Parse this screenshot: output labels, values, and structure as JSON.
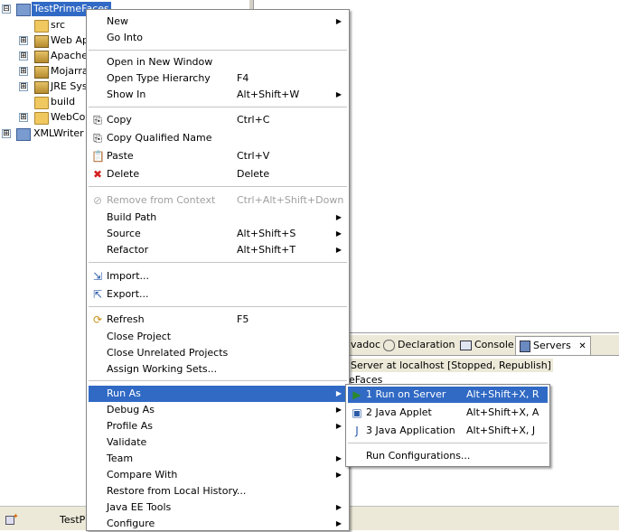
{
  "explorer": {
    "items": [
      {
        "label": "TestPrimeFaces",
        "expander": "⊟"
      },
      {
        "label": "src"
      },
      {
        "label": "Web Ap",
        "expander": "⊞"
      },
      {
        "label": "Apache",
        "expander": "⊞"
      },
      {
        "label": "Mojarra",
        "expander": "⊞"
      },
      {
        "label": "JRE Sys",
        "expander": "⊞"
      },
      {
        "label": "build"
      },
      {
        "label": "WebCor",
        "expander": "⊞"
      },
      {
        "label": "XMLWriter",
        "expander": "⊞"
      }
    ]
  },
  "bottom_tabs": {
    "javadoc": "vadoc",
    "declaration": "Declaration",
    "console": "Console",
    "servers": "Servers",
    "close": "✕"
  },
  "servers_view": {
    "server_line": "Server at localhost  [Stopped, Republish]",
    "child_line": "eFaces"
  },
  "statusbar": {
    "text": "TestPr"
  },
  "context_menu": {
    "new": {
      "label": "New"
    },
    "go_into": {
      "label": "Go Into"
    },
    "open_new_window": {
      "label": "Open in New Window"
    },
    "open_type_hierarchy": {
      "label": "Open Type Hierarchy",
      "accel": "F4"
    },
    "show_in": {
      "label": "Show In",
      "accel": "Alt+Shift+W"
    },
    "copy": {
      "label": "Copy",
      "accel": "Ctrl+C"
    },
    "copy_qualified": {
      "label": "Copy Qualified Name"
    },
    "paste": {
      "label": "Paste",
      "accel": "Ctrl+V"
    },
    "delete": {
      "label": "Delete",
      "accel": "Delete"
    },
    "remove_context": {
      "label": "Remove from Context",
      "accel": "Ctrl+Alt+Shift+Down"
    },
    "build_path": {
      "label": "Build Path"
    },
    "source": {
      "label": "Source",
      "accel": "Alt+Shift+S"
    },
    "refactor": {
      "label": "Refactor",
      "accel": "Alt+Shift+T"
    },
    "import": {
      "label": "Import..."
    },
    "export": {
      "label": "Export..."
    },
    "refresh": {
      "label": "Refresh",
      "accel": "F5"
    },
    "close_project": {
      "label": "Close Project"
    },
    "close_unrelated": {
      "label": "Close Unrelated Projects"
    },
    "assign_working_sets": {
      "label": "Assign Working Sets..."
    },
    "run_as": {
      "label": "Run As"
    },
    "debug_as": {
      "label": "Debug As"
    },
    "profile_as": {
      "label": "Profile As"
    },
    "validate": {
      "label": "Validate"
    },
    "team": {
      "label": "Team"
    },
    "compare_with": {
      "label": "Compare With"
    },
    "restore_history": {
      "label": "Restore from Local History..."
    },
    "java_ee_tools": {
      "label": "Java EE Tools"
    },
    "configure": {
      "label": "Configure"
    }
  },
  "run_as_menu": {
    "run_on_server": {
      "label": "1 Run on Server",
      "accel": "Alt+Shift+X, R"
    },
    "java_applet": {
      "label": "2 Java Applet",
      "accel": "Alt+Shift+X, A"
    },
    "java_application": {
      "label": "3 Java Application",
      "accel": "Alt+Shift+X, J"
    },
    "run_configurations": {
      "label": "Run Configurations..."
    }
  },
  "colors": {
    "selection": "#316ac5",
    "menu_border": "#868686",
    "chrome": "#ece9d8"
  }
}
